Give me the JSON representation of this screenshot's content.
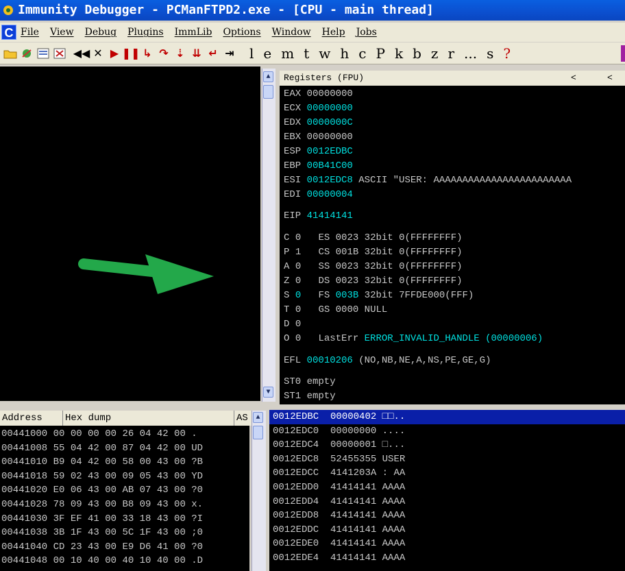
{
  "title": "Immunity Debugger - PCManFTPD2.exe - [CPU - main thread]",
  "menu": [
    "File",
    "View",
    "Debug",
    "Plugins",
    "ImmLib",
    "Options",
    "Window",
    "Help",
    "Jobs"
  ],
  "menu_icon_letter": "C",
  "toolbar": {
    "buttons": [
      "open-icon",
      "restart-icon",
      "console-icon",
      "memory-icon",
      "rewind-icon",
      "close-icon",
      "run-icon",
      "pause-icon",
      "step-into-icon",
      "step-over-icon",
      "trace-into-icon",
      "trace-over-icon",
      "execute-till-return-icon",
      "go-to-icon"
    ],
    "letters": [
      "l",
      "e",
      "m",
      "t",
      "w",
      "h",
      "c",
      "P",
      "k",
      "b",
      "z",
      "r",
      "...",
      "s",
      "?"
    ]
  },
  "registers": {
    "header": "Registers (FPU)",
    "header_nav": [
      "<",
      "<"
    ],
    "lines": [
      {
        "name": "EAX",
        "value": "00000000",
        "extra": ""
      },
      {
        "name": "ECX",
        "value": "00000000",
        "extra": ""
      },
      {
        "name": "EDX",
        "value": "0000000C",
        "extra": ""
      },
      {
        "name": "EBX",
        "value": "00000000",
        "extra": ""
      },
      {
        "name": "ESP",
        "value": "0012EDBC",
        "extra": ""
      },
      {
        "name": "EBP",
        "value": "00B41C00",
        "extra": ""
      },
      {
        "name": "ESI",
        "value": "0012EDC8",
        "extra": " ASCII \"USER: AAAAAAAAAAAAAAAAAAAAAAAA"
      },
      {
        "name": "EDI",
        "value": "00000004",
        "extra": ""
      }
    ],
    "eip": {
      "name": "EIP",
      "value": "41414141"
    },
    "flags": [
      {
        "flag": "C",
        "bit": "0",
        "seg": "ES",
        "sel": "0023",
        "desc": "32bit 0(FFFFFFFF)"
      },
      {
        "flag": "P",
        "bit": "1",
        "seg": "CS",
        "sel": "001B",
        "desc": "32bit 0(FFFFFFFF)"
      },
      {
        "flag": "A",
        "bit": "0",
        "seg": "SS",
        "sel": "0023",
        "desc": "32bit 0(FFFFFFFF)"
      },
      {
        "flag": "Z",
        "bit": "0",
        "seg": "DS",
        "sel": "0023",
        "desc": "32bit 0(FFFFFFFF)"
      },
      {
        "flag": "S",
        "bit": "0",
        "seg": "FS",
        "sel": "003B",
        "desc": "32bit 7FFDE000(FFF)"
      },
      {
        "flag": "T",
        "bit": "0",
        "seg": "GS",
        "sel": "0000",
        "desc": "NULL"
      },
      {
        "flag": "D",
        "bit": "0",
        "seg": "",
        "sel": "",
        "desc": ""
      }
    ],
    "lasterr": {
      "flag": "O",
      "bit": "0",
      "label": "LastErr",
      "value": "ERROR_INVALID_HANDLE (00000006)"
    },
    "efl": {
      "name": "EFL",
      "value": "00010206",
      "extra": " (NO,NB,NE,A,NS,PE,GE,G)"
    },
    "fpu": [
      "ST0 empty",
      "ST1 empty"
    ]
  },
  "dump": {
    "columns": [
      "Address",
      "Hex dump",
      "AS"
    ],
    "rows": [
      {
        "addr": "00441000",
        "hex": "00 00 00 00 26 04 42 00",
        "ascii": "."
      },
      {
        "addr": "00441008",
        "hex": "55 04 42 00 87 04 42 00",
        "ascii": "UD"
      },
      {
        "addr": "00441010",
        "hex": "B9 04 42 00 58 00 43 00",
        "ascii": "?B"
      },
      {
        "addr": "00441018",
        "hex": "59 02 43 00 09 05 43 00",
        "ascii": "YD"
      },
      {
        "addr": "00441020",
        "hex": "E0 06 43 00 AB 07 43 00",
        "ascii": "?0"
      },
      {
        "addr": "00441028",
        "hex": "78 09 43 00 B8 09 43 00",
        "ascii": "x."
      },
      {
        "addr": "00441030",
        "hex": "3F EF 41 00 33 18 43 00",
        "ascii": "?I"
      },
      {
        "addr": "00441038",
        "hex": "3B 1F 43 00 5C 1F 43 00",
        "ascii": ";0"
      },
      {
        "addr": "00441040",
        "hex": "CD 23 43 00 E9 D6 41 00",
        "ascii": "?0"
      },
      {
        "addr": "00441048",
        "hex": "00 10 40 00 40 10 40 00",
        "ascii": ".D"
      }
    ]
  },
  "stack": [
    {
      "addr": "0012EDBC",
      "val": "00000402",
      "text": "□□.."
    },
    {
      "addr": "0012EDC0",
      "val": "00000000",
      "text": "...."
    },
    {
      "addr": "0012EDC4",
      "val": "00000001",
      "text": "□..."
    },
    {
      "addr": "0012EDC8",
      "val": "52455355",
      "text": "USER"
    },
    {
      "addr": "0012EDCC",
      "val": "4141203A",
      "text": ": AA"
    },
    {
      "addr": "0012EDD0",
      "val": "41414141",
      "text": "AAAA"
    },
    {
      "addr": "0012EDD4",
      "val": "41414141",
      "text": "AAAA"
    },
    {
      "addr": "0012EDD8",
      "val": "41414141",
      "text": "AAAA"
    },
    {
      "addr": "0012EDDC",
      "val": "41414141",
      "text": "AAAA"
    },
    {
      "addr": "0012EDE0",
      "val": "41414141",
      "text": "AAAA"
    },
    {
      "addr": "0012EDE4",
      "val": "41414141",
      "text": "AAAA"
    }
  ],
  "colors": {
    "title": "#0b4fcf",
    "accent": "#00e0e0",
    "selection": "#0a1fa8",
    "arrow": "#23a84a"
  }
}
